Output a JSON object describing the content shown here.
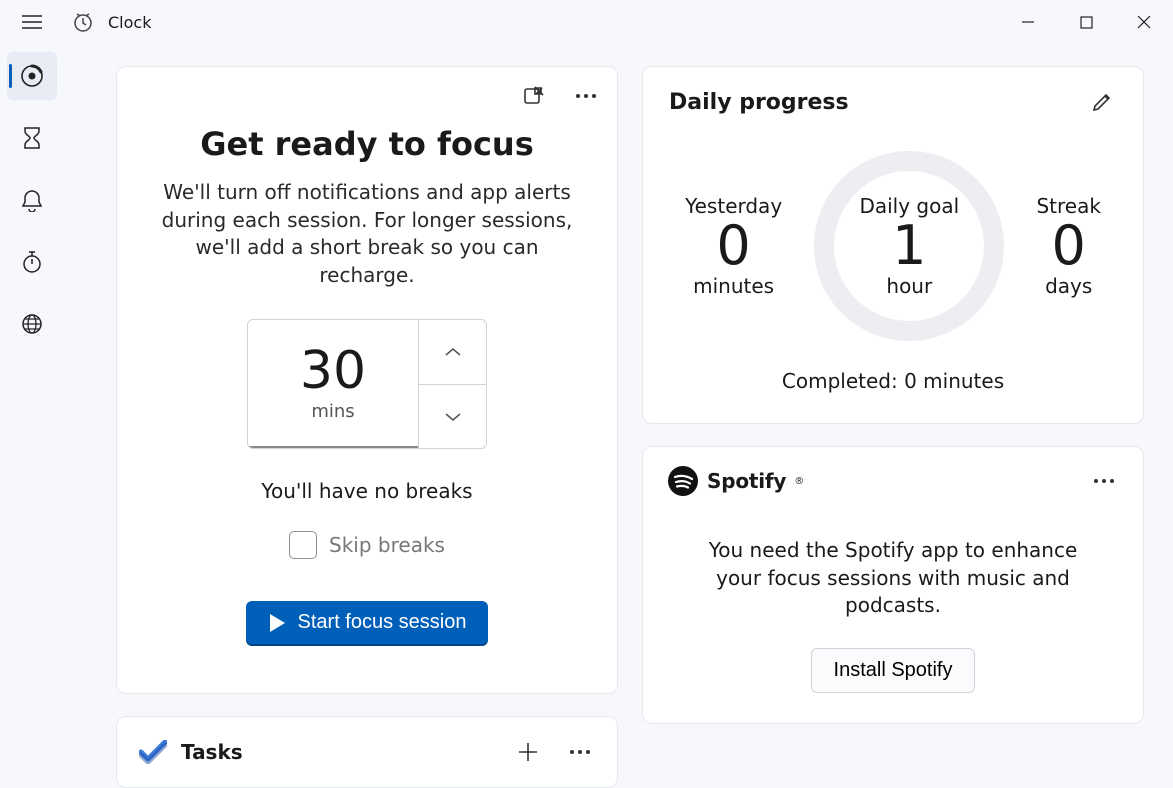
{
  "app": {
    "title": "Clock"
  },
  "sidebar": {
    "items": [
      {
        "name": "focus-sessions-icon"
      },
      {
        "name": "timer-icon"
      },
      {
        "name": "alarm-icon"
      },
      {
        "name": "stopwatch-icon"
      },
      {
        "name": "world-clock-icon"
      }
    ]
  },
  "focus": {
    "heading": "Get ready to focus",
    "description": "We'll turn off notifications and app alerts during each session. For longer sessions, we'll add a short break so you can recharge.",
    "duration_value": "30",
    "duration_unit": "mins",
    "breaks_text": "You'll have no breaks",
    "skip_label": "Skip breaks",
    "start_label": "Start focus session"
  },
  "tasks": {
    "title": "Tasks"
  },
  "progress": {
    "title": "Daily progress",
    "yesterday": {
      "label": "Yesterday",
      "value": "0",
      "unit": "minutes"
    },
    "goal": {
      "label": "Daily goal",
      "value": "1",
      "unit": "hour"
    },
    "streak": {
      "label": "Streak",
      "value": "0",
      "unit": "days"
    },
    "completed": "Completed: 0 minutes"
  },
  "spotify": {
    "name": "Spotify",
    "description": "You need the Spotify app to enhance your focus sessions with music and podcasts.",
    "install_label": "Install Spotify"
  }
}
